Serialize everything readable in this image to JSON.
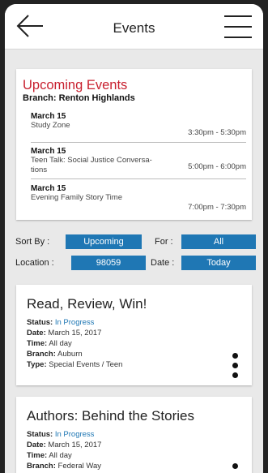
{
  "header": {
    "title": "Events"
  },
  "upcoming": {
    "title": "Upcoming Events",
    "branch": "Branch: Renton Highlands",
    "events": [
      {
        "date": "March 15",
        "name": "Study Zone",
        "time": "3:30pm - 5:30pm"
      },
      {
        "date": "March 15",
        "name": "Teen Talk: Social Justice Conversa-tions",
        "name_line1": "Teen Talk: Social Justice Conversa-",
        "name_line2": "tions",
        "time": "5:00pm - 6:00pm"
      },
      {
        "date": "March 15",
        "name": "Evening Family Story Time",
        "time": "7:00pm - 7:30pm"
      }
    ]
  },
  "filters": {
    "sort_label": "Sort By :",
    "sort_value": "Upcoming",
    "for_label": "For :",
    "for_value": "All",
    "location_label": "Location :",
    "location_value": "98059",
    "date_label": "Date :",
    "date_value": "Today"
  },
  "events": [
    {
      "title": "Read, Review, Win!",
      "status_label": "Status:",
      "status": "In Progress",
      "date_label": "Date:",
      "date": "March 15, 2017",
      "time_label": "Time:",
      "time": "All day",
      "branch_label": "Branch:",
      "branch": "Auburn",
      "type_label": "Type:",
      "type": "Special Events / Teen"
    },
    {
      "title": "Authors: Behind the Stories",
      "status_label": "Status:",
      "status": "In Progress",
      "date_label": "Date:",
      "date": "March 15, 2017",
      "time_label": "Time:",
      "time": "All day",
      "branch_label": "Branch:",
      "branch": "Federal Way"
    }
  ],
  "colors": {
    "accent": "#1f77b4",
    "heading_red": "#c8202f"
  }
}
